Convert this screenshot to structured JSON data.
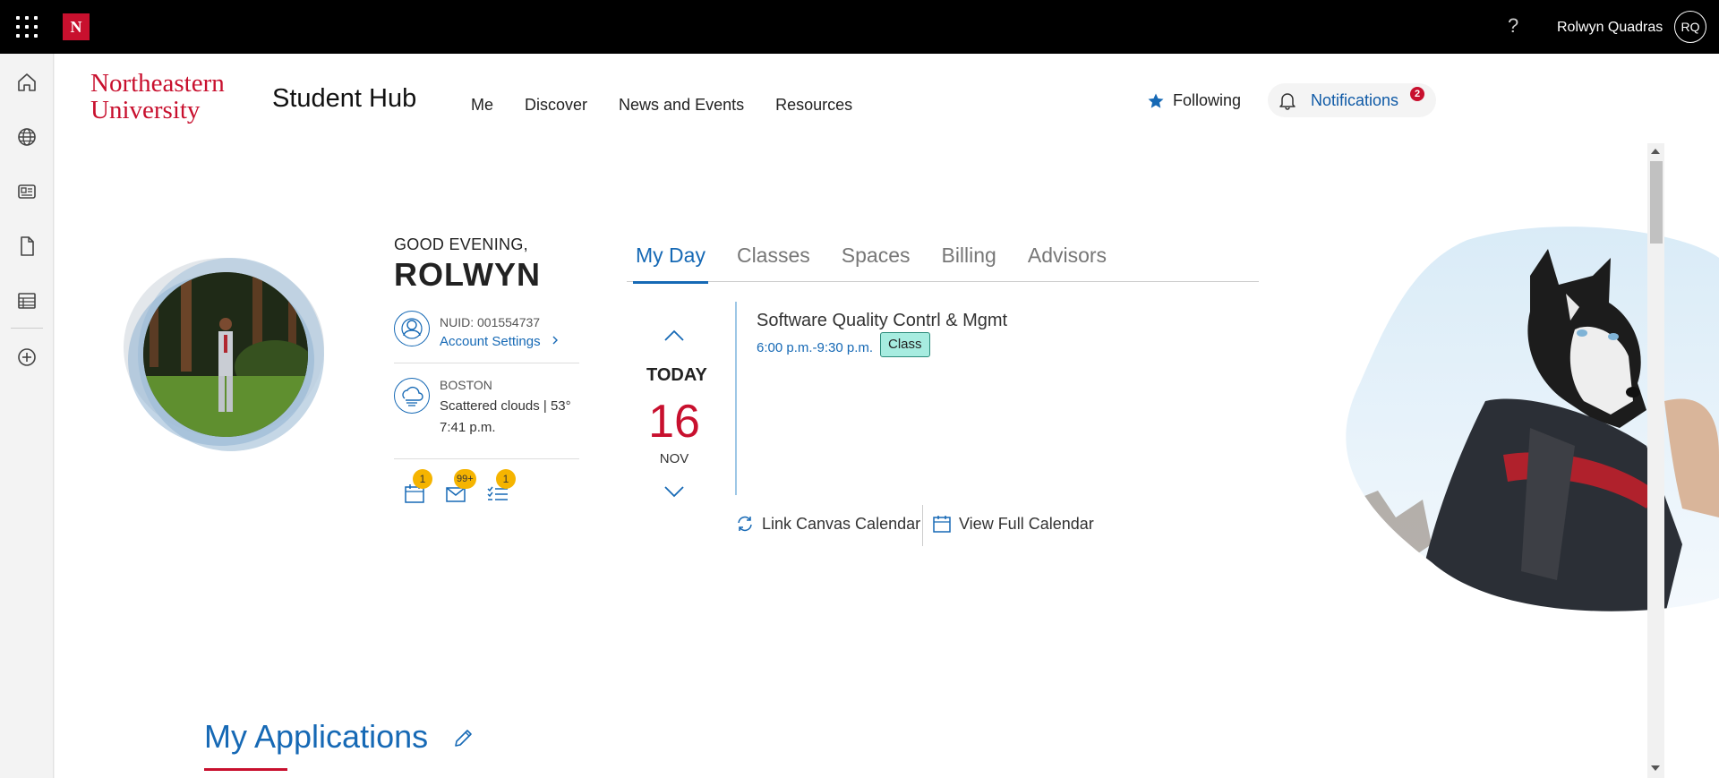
{
  "topbar": {
    "app_launcher_icon": "waffle-grid-icon",
    "logo_letter": "N",
    "help_label": "?",
    "user_name": "Rolwyn Quadras",
    "user_initials": "RQ"
  },
  "rail": {
    "items": [
      "home-icon",
      "globe-icon",
      "id-card-icon",
      "document-icon",
      "table-icon",
      "add-icon"
    ]
  },
  "header": {
    "brand_line1": "Northeastern",
    "brand_line2": "University",
    "title": "Student Hub",
    "nav": [
      "Me",
      "Discover",
      "News and Events",
      "Resources"
    ],
    "following_label": "Following",
    "notifications_label": "Notifications",
    "notifications_count": "2"
  },
  "profile": {
    "greeting": "GOOD EVENING,",
    "name": "ROLWYN",
    "nuid": "NUID: 001554737",
    "account_settings": "Account Settings",
    "city": "BOSTON",
    "weather": "Scattered clouds | 53°",
    "time": "7:41 p.m.",
    "quick_links": [
      {
        "icon": "calendar-icon",
        "badge": "1"
      },
      {
        "icon": "mail-icon",
        "badge": "99+"
      },
      {
        "icon": "tasks-icon",
        "badge": "1"
      }
    ]
  },
  "tabs": [
    "My Day",
    "Classes",
    "Spaces",
    "Billing",
    "Advisors"
  ],
  "active_tab": "My Day",
  "day": {
    "label": "TODAY",
    "number": "16",
    "month": "NOV"
  },
  "events": [
    {
      "title": "Software Quality Contrl & Mgmt",
      "time": "6:00 p.m.-9:30 p.m.",
      "tag": "Class"
    }
  ],
  "calendar_actions": {
    "link_canvas": "Link Canvas Calendar",
    "view_full": "View Full Calendar"
  },
  "sections": {
    "my_applications": "My Applications"
  },
  "colors": {
    "brand_red": "#c8102e",
    "accent_blue": "#1669b5",
    "badge_yellow": "#f5b400",
    "tag_teal": "#a7ece0"
  }
}
